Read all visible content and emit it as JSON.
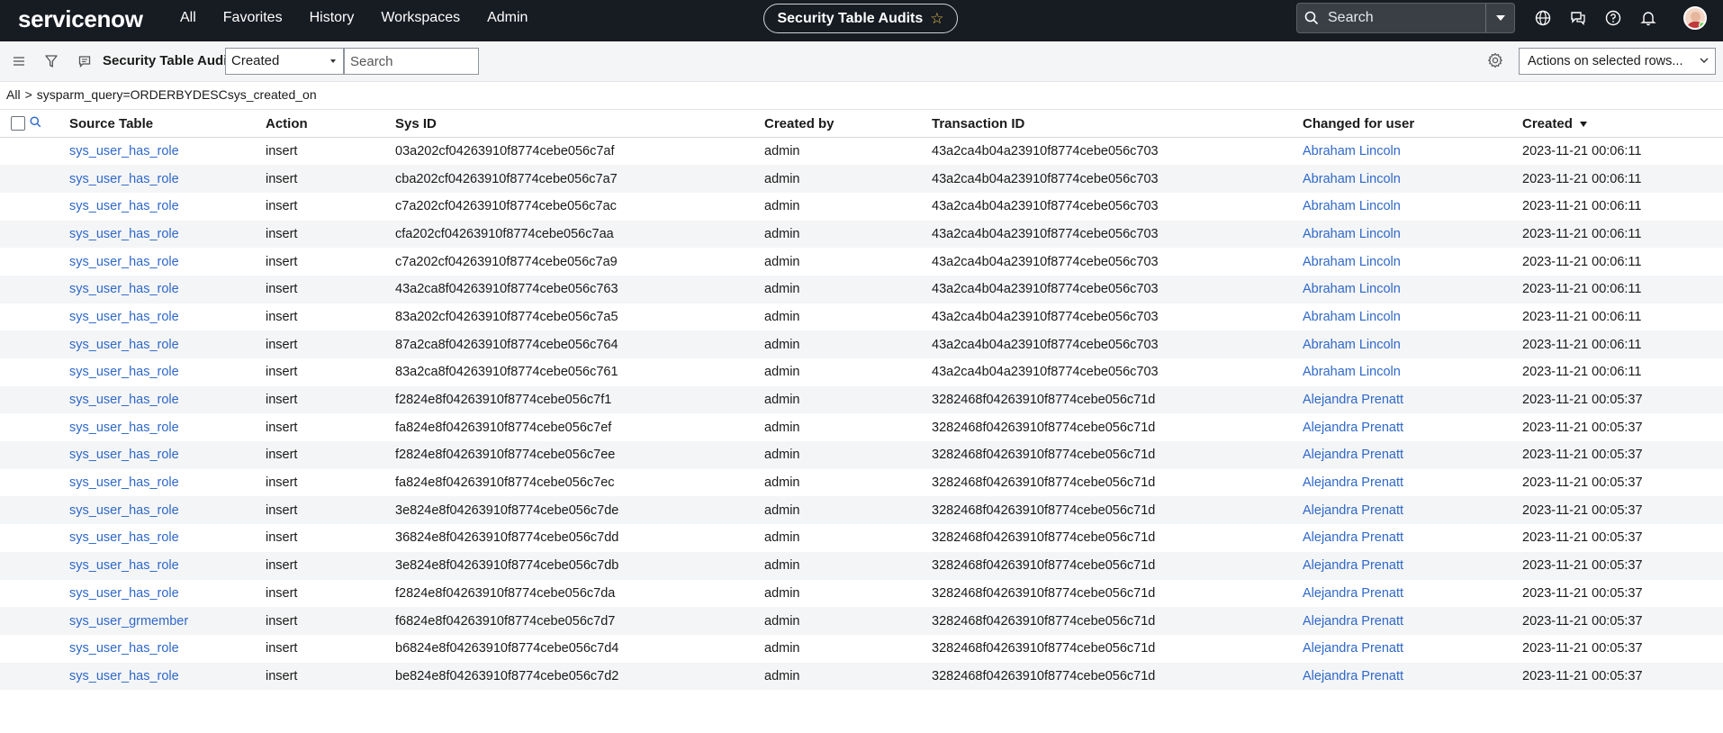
{
  "nav": {
    "logo": "servicenow",
    "menu": [
      "All",
      "Favorites",
      "History",
      "Workspaces",
      "Admin"
    ],
    "page_title": "Security Table Audits",
    "search_placeholder": "Search"
  },
  "toolbar": {
    "list_title": "Security Table Audits",
    "field_select": "Created",
    "search_placeholder": "Search",
    "actions": "Actions on selected rows..."
  },
  "breadcrumb": {
    "root": "All",
    "separator": ">",
    "query": "sysparm_query=ORDERBYDESCsys_created_on"
  },
  "table": {
    "columns": [
      "Source Table",
      "Action",
      "Sys ID",
      "Created by",
      "Transaction ID",
      "Changed for user",
      "Created"
    ],
    "rows": [
      [
        "sys_user_has_role",
        "insert",
        "03a202cf04263910f8774cebe056c7af",
        "admin",
        "43a2ca4b04a23910f8774cebe056c703",
        "Abraham Lincoln",
        "2023-11-21 00:06:11"
      ],
      [
        "sys_user_has_role",
        "insert",
        "cba202cf04263910f8774cebe056c7a7",
        "admin",
        "43a2ca4b04a23910f8774cebe056c703",
        "Abraham Lincoln",
        "2023-11-21 00:06:11"
      ],
      [
        "sys_user_has_role",
        "insert",
        "c7a202cf04263910f8774cebe056c7ac",
        "admin",
        "43a2ca4b04a23910f8774cebe056c703",
        "Abraham Lincoln",
        "2023-11-21 00:06:11"
      ],
      [
        "sys_user_has_role",
        "insert",
        "cfa202cf04263910f8774cebe056c7aa",
        "admin",
        "43a2ca4b04a23910f8774cebe056c703",
        "Abraham Lincoln",
        "2023-11-21 00:06:11"
      ],
      [
        "sys_user_has_role",
        "insert",
        "c7a202cf04263910f8774cebe056c7a9",
        "admin",
        "43a2ca4b04a23910f8774cebe056c703",
        "Abraham Lincoln",
        "2023-11-21 00:06:11"
      ],
      [
        "sys_user_has_role",
        "insert",
        "43a2ca8f04263910f8774cebe056c763",
        "admin",
        "43a2ca4b04a23910f8774cebe056c703",
        "Abraham Lincoln",
        "2023-11-21 00:06:11"
      ],
      [
        "sys_user_has_role",
        "insert",
        "83a202cf04263910f8774cebe056c7a5",
        "admin",
        "43a2ca4b04a23910f8774cebe056c703",
        "Abraham Lincoln",
        "2023-11-21 00:06:11"
      ],
      [
        "sys_user_has_role",
        "insert",
        "87a2ca8f04263910f8774cebe056c764",
        "admin",
        "43a2ca4b04a23910f8774cebe056c703",
        "Abraham Lincoln",
        "2023-11-21 00:06:11"
      ],
      [
        "sys_user_has_role",
        "insert",
        "83a2ca8f04263910f8774cebe056c761",
        "admin",
        "43a2ca4b04a23910f8774cebe056c703",
        "Abraham Lincoln",
        "2023-11-21 00:06:11"
      ],
      [
        "sys_user_has_role",
        "insert",
        "f2824e8f04263910f8774cebe056c7f1",
        "admin",
        "3282468f04263910f8774cebe056c71d",
        "Alejandra Prenatt",
        "2023-11-21 00:05:37"
      ],
      [
        "sys_user_has_role",
        "insert",
        "fa824e8f04263910f8774cebe056c7ef",
        "admin",
        "3282468f04263910f8774cebe056c71d",
        "Alejandra Prenatt",
        "2023-11-21 00:05:37"
      ],
      [
        "sys_user_has_role",
        "insert",
        "f2824e8f04263910f8774cebe056c7ee",
        "admin",
        "3282468f04263910f8774cebe056c71d",
        "Alejandra Prenatt",
        "2023-11-21 00:05:37"
      ],
      [
        "sys_user_has_role",
        "insert",
        "fa824e8f04263910f8774cebe056c7ec",
        "admin",
        "3282468f04263910f8774cebe056c71d",
        "Alejandra Prenatt",
        "2023-11-21 00:05:37"
      ],
      [
        "sys_user_has_role",
        "insert",
        "3e824e8f04263910f8774cebe056c7de",
        "admin",
        "3282468f04263910f8774cebe056c71d",
        "Alejandra Prenatt",
        "2023-11-21 00:05:37"
      ],
      [
        "sys_user_has_role",
        "insert",
        "36824e8f04263910f8774cebe056c7dd",
        "admin",
        "3282468f04263910f8774cebe056c71d",
        "Alejandra Prenatt",
        "2023-11-21 00:05:37"
      ],
      [
        "sys_user_has_role",
        "insert",
        "3e824e8f04263910f8774cebe056c7db",
        "admin",
        "3282468f04263910f8774cebe056c71d",
        "Alejandra Prenatt",
        "2023-11-21 00:05:37"
      ],
      [
        "sys_user_has_role",
        "insert",
        "f2824e8f04263910f8774cebe056c7da",
        "admin",
        "3282468f04263910f8774cebe056c71d",
        "Alejandra Prenatt",
        "2023-11-21 00:05:37"
      ],
      [
        "sys_user_grmember",
        "insert",
        "f6824e8f04263910f8774cebe056c7d7",
        "admin",
        "3282468f04263910f8774cebe056c71d",
        "Alejandra Prenatt",
        "2023-11-21 00:05:37"
      ],
      [
        "sys_user_has_role",
        "insert",
        "b6824e8f04263910f8774cebe056c7d4",
        "admin",
        "3282468f04263910f8774cebe056c71d",
        "Alejandra Prenatt",
        "2023-11-21 00:05:37"
      ],
      [
        "sys_user_has_role",
        "insert",
        "be824e8f04263910f8774cebe056c7d2",
        "admin",
        "3282468f04263910f8774cebe056c71d",
        "Alejandra Prenatt",
        "2023-11-21 00:05:37"
      ]
    ]
  },
  "icons": {
    "nav": [
      "globe-icon",
      "chat-icon",
      "help-icon",
      "bell-icon"
    ],
    "toolbar": [
      "hamburger-icon",
      "filter-icon",
      "list-context-icon",
      "gear-icon"
    ]
  },
  "colors": {
    "nav_bg": "#171b22",
    "link": "#2e68c9",
    "stripe": "#f4f5f6",
    "accent_green": "#62d84e"
  }
}
